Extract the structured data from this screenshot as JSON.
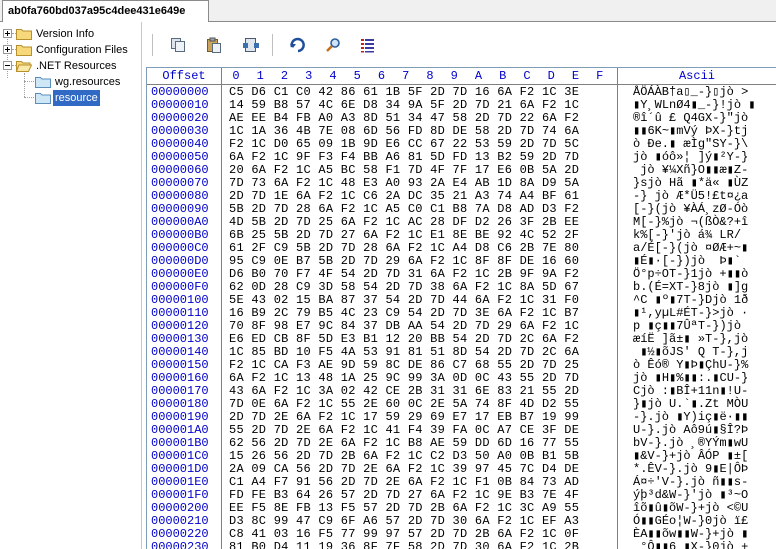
{
  "tab": {
    "title": "ab0fa760bd037a95c4dee431e649e"
  },
  "tree": {
    "nodes": [
      {
        "label": "Version Info",
        "expander": "plus"
      },
      {
        "label": "Configuration Files",
        "expander": "plus"
      },
      {
        "label": ".NET Resources",
        "expander": "minus"
      },
      {
        "label": "wg.resources",
        "expander": "none"
      },
      {
        "label": "resource",
        "expander": "none",
        "selected": true
      }
    ]
  },
  "toolbar": {
    "buttons": [
      {
        "name": "copy-icon"
      },
      {
        "name": "paste-icon"
      },
      {
        "name": "export-icon"
      },
      {
        "name": "goto-icon"
      },
      {
        "name": "search-icon"
      },
      {
        "name": "data-inspector-icon"
      }
    ]
  },
  "hex": {
    "header_offset": "Offset",
    "header_cols": [
      "0",
      "1",
      "2",
      "3",
      "4",
      "5",
      "6",
      "7",
      "8",
      "9",
      "A",
      "B",
      "C",
      "D",
      "E",
      "F"
    ],
    "header_ascii": "Ascii",
    "rows": [
      {
        "offset": "00000000",
        "bytes": "C5 D6 C1 C0 42 86 61 1B 5F 2D 7D 16 6A F2 1C 3E",
        "ascii": "ÅÖÁÀB†a▯_-}▯jò >"
      },
      {
        "offset": "00000010",
        "bytes": "14 59 B8 57 4C 6E D8 34 9A 5F 2D 7D 21 6A F2 1C",
        "ascii": "▮Y¸WLnØ4▮_-}!jò ▮"
      },
      {
        "offset": "00000020",
        "bytes": "AE EE B4 FB A0 A3 8D 51 34 47 58 2D 7D 22 6A F2",
        "ascii": "®î´û £ Q4GX-}\"jò"
      },
      {
        "offset": "00000030",
        "bytes": "1C 1A 36 4B 7E 08 6D 56 FD 8D DE 58 2D 7D 74 6A",
        "ascii": "▮▮6K~▮mVý ÞX-}tj"
      },
      {
        "offset": "00000040",
        "bytes": "F2 1C D0 65 09 1B 9D E6 CC 67 22 53 59 2D 7D 5C",
        "ascii": "ò Ðe.▮ æÌg\"SY-}\\"
      },
      {
        "offset": "00000050",
        "bytes": "6A F2 1C 9F F3 F4 BB A6 81 5D FD 13 B2 59 2D 7D",
        "ascii": "jò ▮óô»¦ ]ý▮²Y-}"
      },
      {
        "offset": "00000060",
        "bytes": "20 6A F2 1C A5 BC 58 F1 7D 4F 7F 17 E6 0B 5A 2D",
        "ascii": " jò ¥¼Xñ}O▮▮æ▮Z-"
      },
      {
        "offset": "00000070",
        "bytes": "7D 73 6A F2 1C 48 E3 A0 93 2A E4 AB 1D 8A D9 5A",
        "ascii": "}sjò Hã ▮*ä« ▮ÙZ"
      },
      {
        "offset": "00000080",
        "bytes": "2D 7D 1E 6A F2 1C C6 2A DC 35 21 A3 74 A4 BF 61",
        "ascii": "-} jò Æ*Ü5!£t¤¿a"
      },
      {
        "offset": "00000090",
        "bytes": "5B 2D 7D 28 6A F2 1C A5 C0 C1 B8 7A D8 AD D3 F2",
        "ascii": "[-}(jò ¥ÀÁ¸zØ-Óò"
      },
      {
        "offset": "000000A0",
        "bytes": "4D 5B 2D 7D 25 6A F2 1C AC 28 DF D2 26 3F 2B EE",
        "ascii": "M[-}%jò ¬(ßÒ&?+î"
      },
      {
        "offset": "000000B0",
        "bytes": "6B 25 5B 2D 7D 27 6A F2 1C E1 8E BE 92 4C 52 2F",
        "ascii": "k%[-}'jò á¾ LR/"
      },
      {
        "offset": "000000C0",
        "bytes": "61 2F C9 5B 2D 7D 28 6A F2 1C A4 D8 C6 2B 7E 80",
        "ascii": "a/É[-}(jò ¤ØÆ+~▮"
      },
      {
        "offset": "000000D0",
        "bytes": "95 C9 0E B7 5B 2D 7D 29 6A F2 1C 8F 8F DE 16 60",
        "ascii": "▮É▮·[-})jò  Þ▮`"
      },
      {
        "offset": "000000E0",
        "bytes": "D6 B0 70 F7 4F 54 2D 7D 31 6A F2 1C 2B 9F 9A F2",
        "ascii": "Ö°p÷OT-}1jò +▮▮ò"
      },
      {
        "offset": "000000F0",
        "bytes": "62 0D 28 C9 3D 58 54 2D 7D 38 6A F2 1C 8A 5D 67",
        "ascii": "b.(É=XT-}8jò ▮]g"
      },
      {
        "offset": "00000100",
        "bytes": "5E 43 02 15 BA 87 37 54 2D 7D 44 6A F2 1C 31 F0",
        "ascii": "^C ▮º▮7T-}Djò 1ð"
      },
      {
        "offset": "00000110",
        "bytes": "16 B9 2C 79 B5 4C 23 C9 54 2D 7D 3E 6A F2 1C B7",
        "ascii": "▮¹,yµL#ÉT-}>jò ·"
      },
      {
        "offset": "00000120",
        "bytes": "70 8F 98 E7 9C 84 37 DB AA 54 2D 7D 29 6A F2 1C",
        "ascii": "p ▮ç▮▮7ÛªT-})jò "
      },
      {
        "offset": "00000130",
        "bytes": "E6 ED CB 8F 5D E3 B1 12 20 BB 54 2D 7D 2C 6A F2",
        "ascii": "æíË ]ã±▮ »T-},jò"
      },
      {
        "offset": "00000140",
        "bytes": "1C 85 BD 10 F5 4A 53 91 81 51 8D 54 2D 7D 2C 6A",
        "ascii": " ▮½▮õJS' Q T-},j"
      },
      {
        "offset": "00000150",
        "bytes": "F2 1C CA F3 AE 9D 59 8C DE 86 C7 68 55 2D 7D 25",
        "ascii": "ò Êó® Y▮Þ▮ÇhU-}%"
      },
      {
        "offset": "00000160",
        "bytes": "6A F2 1C 13 48 1A 25 9C 99 3A 0D 0C 43 55 2D 7D",
        "ascii": "jò ▮H▮%▮▮:.▮CU-}"
      },
      {
        "offset": "00000170",
        "bytes": "43 6A F2 1C 3A 02 42 CE 2B 31 31 6E 83 21 55 2D",
        "ascii": "Cjò :▮BÎ+11n▮!U-"
      },
      {
        "offset": "00000180",
        "bytes": "7D 0E 6A F2 1C 55 2E 60 0C 2E 5A 74 8F 4D D2 55",
        "ascii": "}▮jò U.`▮.Zt MÒU"
      },
      {
        "offset": "00000190",
        "bytes": "2D 7D 2E 6A F2 1C 17 59 29 69 E7 17 EB B7 19 99",
        "ascii": "-}.jò ▮Y)iç▮ë·▮▮"
      },
      {
        "offset": "000001A0",
        "bytes": "55 2D 7D 2E 6A F2 1C 41 F4 39 FA 0C A7 CE 3F DE",
        "ascii": "U-}.jò Aô9ú▮§Î?Þ"
      },
      {
        "offset": "000001B0",
        "bytes": "62 56 2D 7D 2E 6A F2 1C B8 AE 59 DD 6D 16 77 55",
        "ascii": "bV-}.jò ¸®YÝm▮wU"
      },
      {
        "offset": "000001C0",
        "bytes": "15 26 56 2D 7D 2B 6A F2 1C C2 D3 50 A0 0B B1 5B",
        "ascii": "▮&V-}+jò ÂÓP ▮±["
      },
      {
        "offset": "000001D0",
        "bytes": "2A 09 CA 56 2D 7D 2E 6A F2 1C 39 97 45 7C D4 DE",
        "ascii": "*.ÊV-}.jò 9▮E|ÔÞ"
      },
      {
        "offset": "000001E0",
        "bytes": "C1 A4 F7 91 56 2D 7D 2E 6A F2 1C F1 0B 84 73 AD",
        "ascii": "Á¤÷'V-}.jò ñ▮▮s-"
      },
      {
        "offset": "000001F0",
        "bytes": "FD FE B3 64 26 57 2D 7D 27 6A F2 1C 9E B3 7E 4F",
        "ascii": "ýþ³d&W-}'jò ▮³~O"
      },
      {
        "offset": "00000200",
        "bytes": "EE F5 8E FB 13 F5 57 2D 7D 2B 6A F2 1C 3C A9 55",
        "ascii": "îõ▮û▮õW-}+jò <©U"
      },
      {
        "offset": "00000210",
        "bytes": "D3 8C 99 47 C9 6F A6 57 2D 7D 30 6A F2 1C EF A3",
        "ascii": "Ó▮▮GÉo¦W-}0jò ï£"
      },
      {
        "offset": "00000220",
        "bytes": "C8 41 03 16 F5 77 99 97 57 2D 7D 2B 6A F2 1C 0F",
        "ascii": "ÈA▮▮õw▮▮W-}+jò ▮"
      },
      {
        "offset": "00000230",
        "bytes": "81 B0 D4 11 19 36 8F 7F 58 2D 7D 30 6A F2 1C 2B",
        "ascii": " °Ô▮▮6 ▮X-}0jò +"
      }
    ]
  }
}
